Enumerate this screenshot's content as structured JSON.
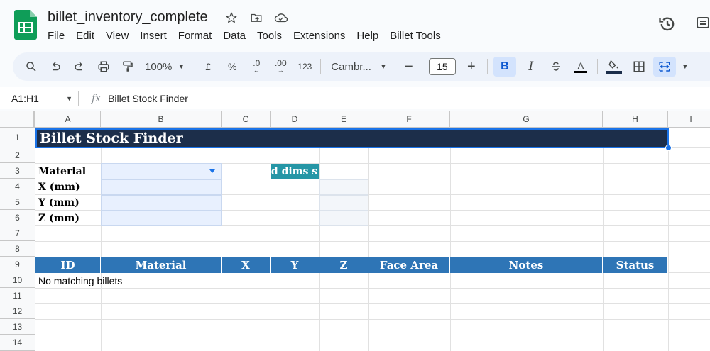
{
  "app": {
    "doc_title": "billet_inventory_complete",
    "menu": [
      "File",
      "Edit",
      "View",
      "Insert",
      "Format",
      "Data",
      "Tools",
      "Extensions",
      "Help",
      "Billet Tools"
    ]
  },
  "toolbar": {
    "zoom": "100%",
    "currency": "£",
    "percent": "%",
    "dec_decrease": ".0",
    "dec_increase": ".00",
    "number_format": "123",
    "font_name": "Cambr...",
    "font_size": "15",
    "bold": "B",
    "italic": "I",
    "text_color": "A"
  },
  "formula_bar": {
    "name_box": "A1:H1",
    "fx": "fx",
    "content": "Billet Stock Finder"
  },
  "grid": {
    "columns": [
      "A",
      "B",
      "C",
      "D",
      "E",
      "F",
      "G",
      "H",
      "I"
    ],
    "rows": [
      "1",
      "2",
      "3",
      "4",
      "5",
      "6",
      "7",
      "8",
      "9",
      "10",
      "11",
      "12",
      "13",
      "14"
    ]
  },
  "sheet": {
    "title": "Billet Stock Finder",
    "labels": [
      "Material",
      "X (mm)",
      "Y (mm)",
      "Z (mm)"
    ],
    "teal_text": "ed dims s",
    "table_headers": [
      "ID",
      "Material",
      "X",
      "Y",
      "Z",
      "Face Area",
      "Notes",
      "Status"
    ],
    "no_match": "No matching billets"
  },
  "colors": {
    "title_bg": "#1c2e4a",
    "header_bg": "#2e75b6",
    "teal": "#2596a6",
    "input_bg": "#e8f0fe",
    "selection": "#1a73e8"
  }
}
